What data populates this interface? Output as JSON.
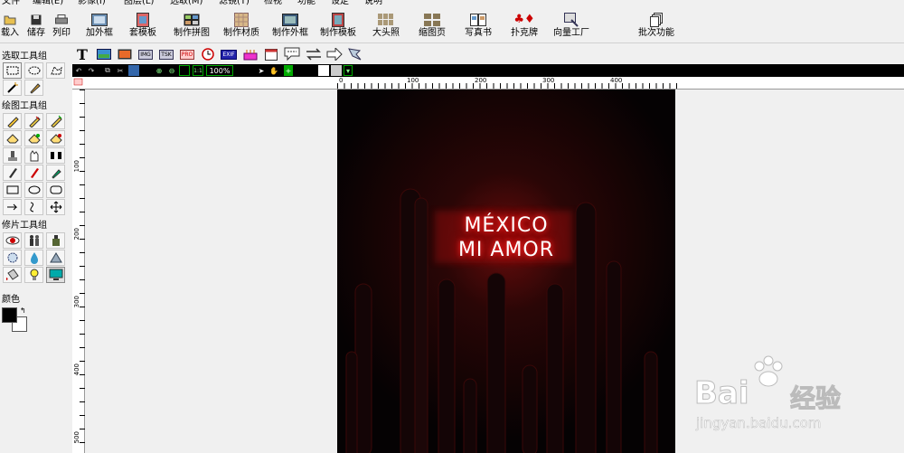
{
  "menu": [
    "文件",
    "编辑(E)",
    "影像(I)",
    "图层(L)",
    "选取(M)",
    "滤镜(T)",
    "检视",
    "功能",
    "设定",
    "说明"
  ],
  "toolbar": {
    "load": "载入",
    "save": "储存",
    "print": "列印",
    "add_frame": "加外框",
    "apply_template": "套模板",
    "make_collage": "制作拼图",
    "make_material": "制作材质",
    "make_frame": "制作外框",
    "make_template": "制作模板",
    "big_head": "大头照",
    "thumbnail_page": "缩图页",
    "photo_book": "写真书",
    "poker": "扑克牌",
    "vector_factory": "向量工厂",
    "batch": "批次功能"
  },
  "toolbar2": {
    "text_tool": "T",
    "img_badge": "IMG",
    "tsk_badge": "TSK",
    "pro_badge": "PRO",
    "exif_badge": "EXIF"
  },
  "toolbar3": {
    "zoom_level": "100%",
    "actual_size": "1:1"
  },
  "left_panel": {
    "select_group_title": "选取工具组",
    "draw_group_title": "绘图工具组",
    "retouch_group_title": "修片工具组",
    "color_title": "颜色",
    "foreground_color": "#000000",
    "background_color": "#ffffff"
  },
  "ruler": {
    "top_ticks": [
      "0",
      "100",
      "200",
      "300",
      "400"
    ],
    "left_ticks": [
      "100",
      "200",
      "300",
      "400",
      "500"
    ]
  },
  "photo": {
    "sign_line1": "MÉXICO",
    "sign_line2": "MI AMOR",
    "neon_color": "#ff2a2a"
  },
  "watermark": {
    "brand": "Bai",
    "brand_cn": "经验",
    "url": "jingyan.baidu.com"
  }
}
